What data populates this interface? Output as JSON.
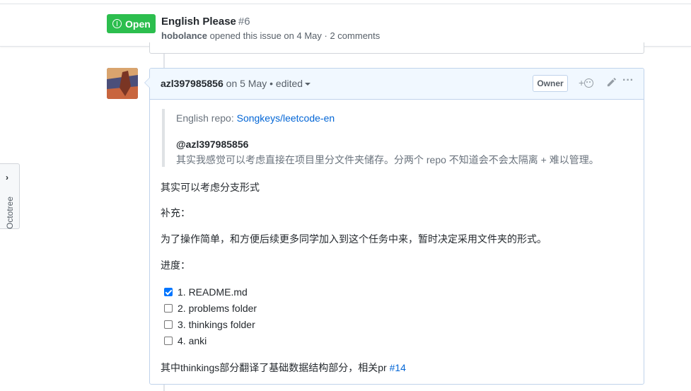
{
  "header": {
    "state": "Open",
    "title": "English Please",
    "number": "#6",
    "author": "hobolance",
    "meta": "opened this issue on 4 May · 2 comments"
  },
  "octotree": {
    "label": "Octotree",
    "chevron": "›"
  },
  "comment": {
    "author": "azl397985856",
    "date": "on 5 May",
    "edited": "• edited",
    "owner_badge": "Owner",
    "reaction_plus": "+",
    "more": "···",
    "quote": {
      "line1_prefix": "English repo: ",
      "line1_link": "Songkeys/leetcode-en",
      "mention": "@azl397985856",
      "line3": "其实我感觉可以考虑直接在项目里分文件夹储存。分两个 repo 不知道会不会太隔离 + 难以管理。"
    },
    "paragraphs": {
      "p1": "其实可以考虑分支形式",
      "p2": "补充：",
      "p3": "为了操作简单，和方便后续更多同学加入到这个任务中来，暂时决定采用文件夹的形式。",
      "p4": "进度："
    },
    "tasks": [
      {
        "label": "1. README.md",
        "checked": true
      },
      {
        "label": "2. problems folder",
        "checked": false
      },
      {
        "label": "3. thinkings folder",
        "checked": false
      },
      {
        "label": "4. anki",
        "checked": false
      }
    ],
    "footer_text": "其中thinkings部分翻译了基础数据结构部分，相关pr ",
    "footer_link": "#14"
  },
  "colors": {
    "open_green": "#2cbe4e",
    "link_blue": "#0366d6",
    "comment_header_bg": "#f1f8ff"
  },
  "icons": [
    "issue-opened-icon",
    "chevron-right-icon",
    "smiley-icon",
    "pencil-icon",
    "kebab-horizontal-icon",
    "caret-down-icon",
    "checkbox-icon"
  ]
}
